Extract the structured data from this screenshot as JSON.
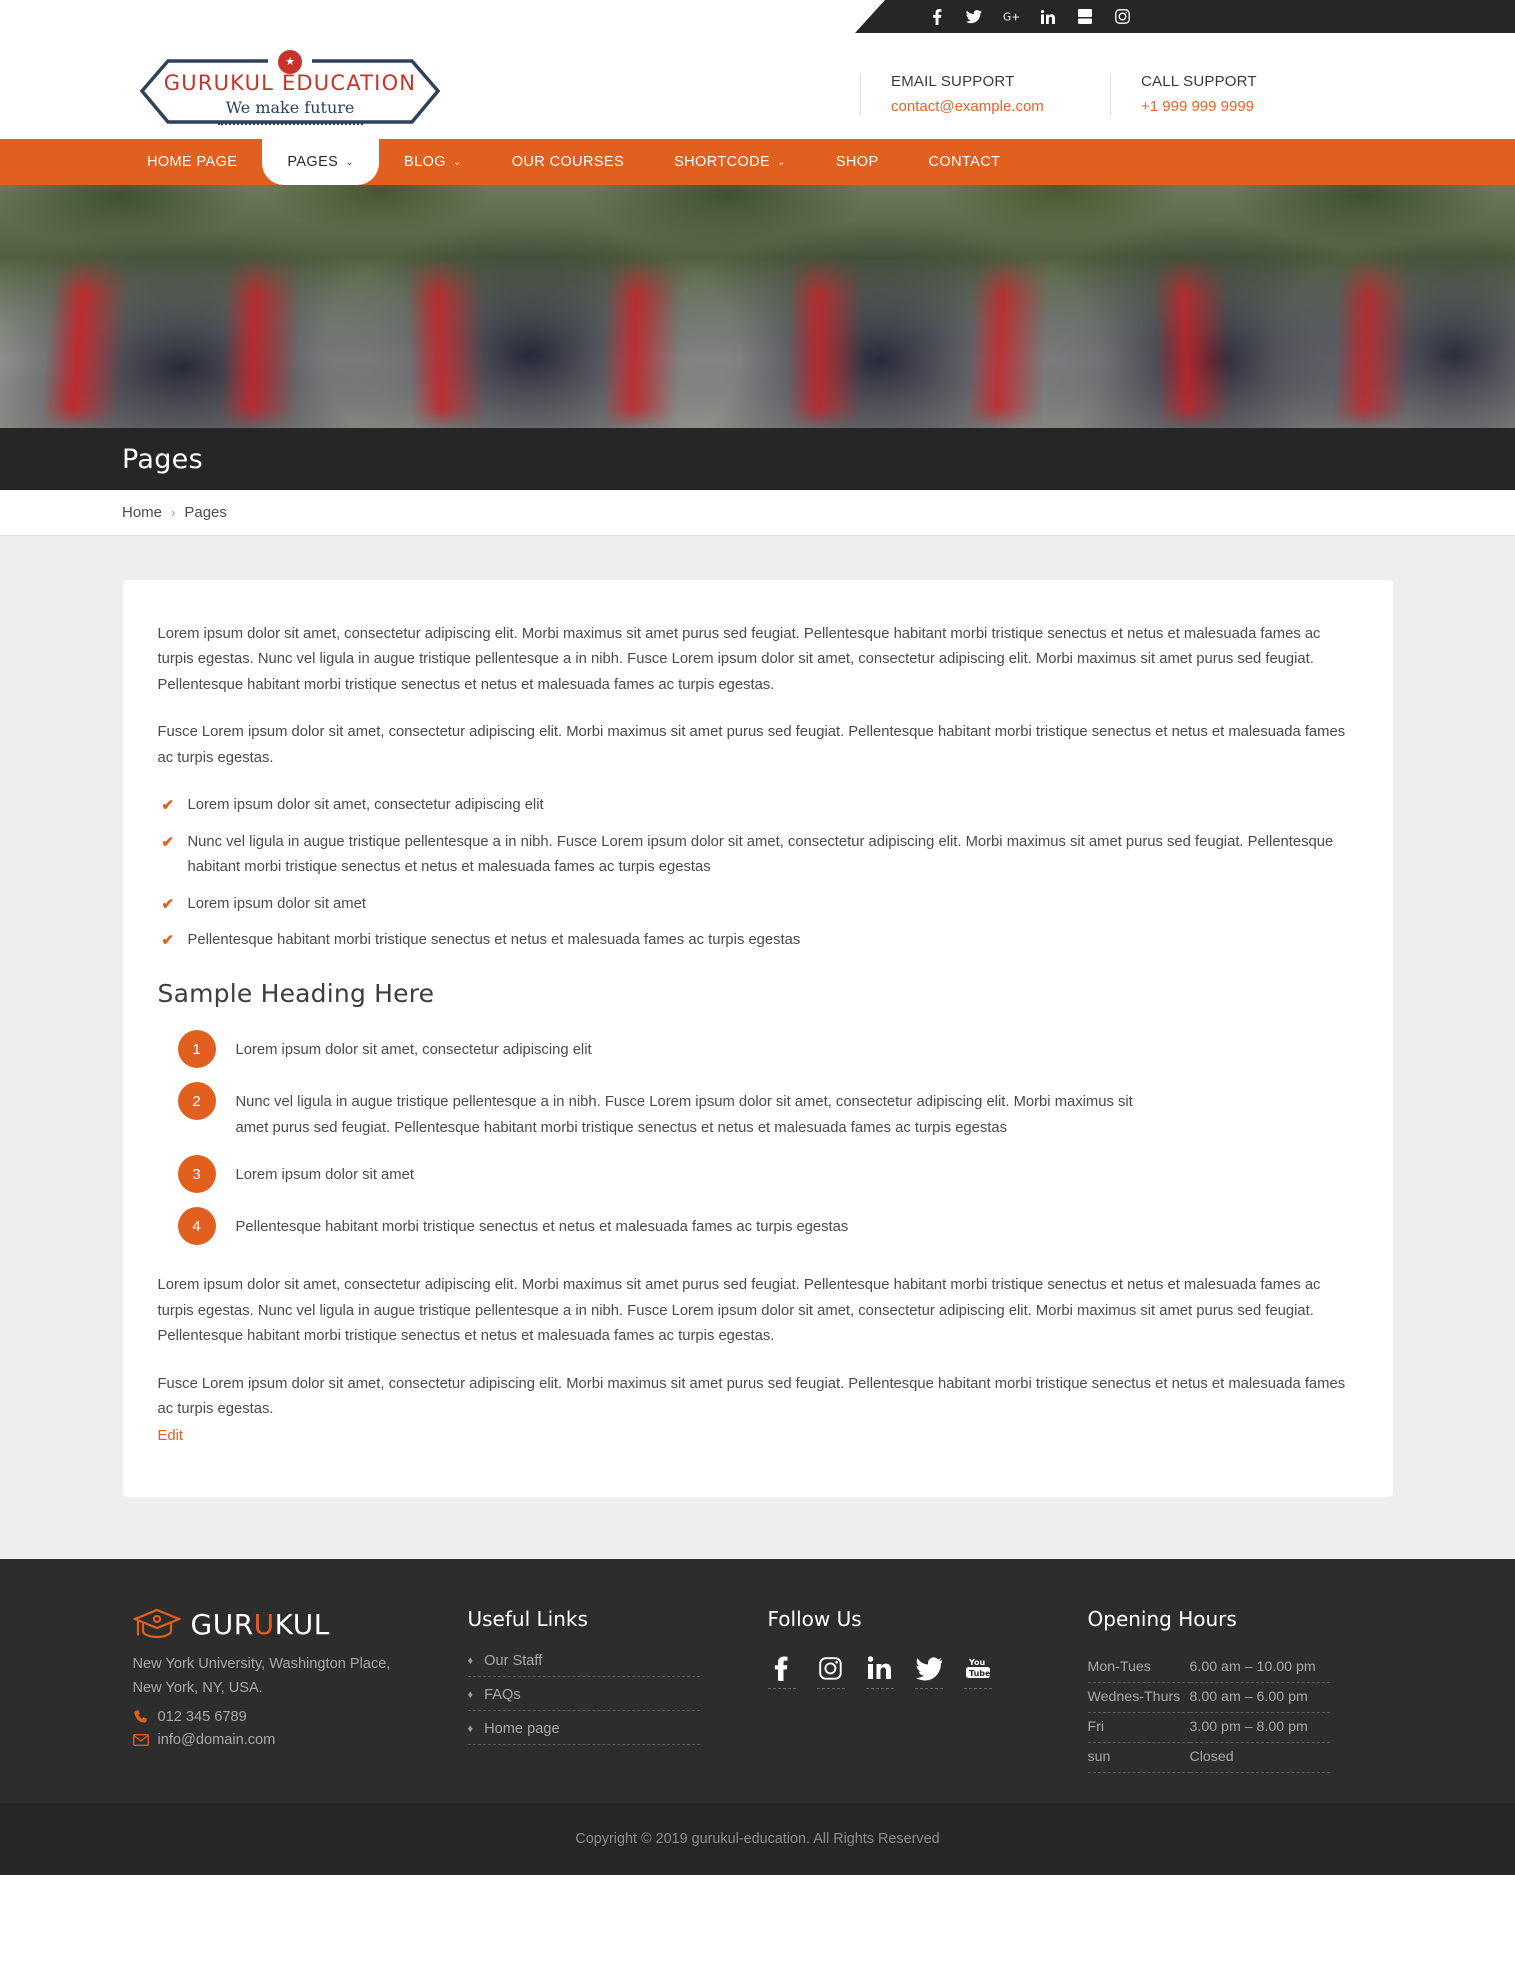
{
  "topbar": {
    "social": [
      {
        "name": "facebook-icon",
        "label": "f"
      },
      {
        "name": "twitter-icon",
        "label": "Twitter"
      },
      {
        "name": "google-plus-icon",
        "label": "G+"
      },
      {
        "name": "linkedin-icon",
        "label": "in"
      },
      {
        "name": "youtube-icon",
        "label": "YouTube"
      },
      {
        "name": "instagram-icon",
        "label": "Instagram"
      }
    ]
  },
  "logo": {
    "title": "Gurukul Education",
    "subtitle": "We make future",
    "badge": "★"
  },
  "support": {
    "email_label": "EMAIL SUPPORT",
    "email_value": "contact@example.com",
    "call_label": "CALL SUPPORT",
    "call_value": "+1 999 999 9999"
  },
  "nav": {
    "items": [
      {
        "label": "HOME PAGE",
        "caret": false,
        "active": false
      },
      {
        "label": "PAGES",
        "caret": true,
        "active": true
      },
      {
        "label": "BLOG",
        "caret": true,
        "active": false
      },
      {
        "label": "OUR COURSES",
        "caret": false,
        "active": false
      },
      {
        "label": "SHORTCODE",
        "caret": true,
        "active": false
      },
      {
        "label": "SHOP",
        "caret": false,
        "active": false
      },
      {
        "label": "CONTACT",
        "caret": false,
        "active": false
      }
    ],
    "caret_glyph": "⌄"
  },
  "page": {
    "title": "Pages",
    "breadcrumb_home": "Home",
    "breadcrumb_sep": "›",
    "breadcrumb_current": "Pages"
  },
  "content": {
    "para1": "Lorem ipsum dolor sit amet, consectetur adipiscing elit. Morbi maximus sit amet purus sed feugiat. Pellentesque habitant morbi tristique senectus et netus et malesuada fames ac turpis egestas. Nunc vel ligula in augue tristique pellentesque a in nibh. Fusce Lorem ipsum dolor sit amet, consectetur adipiscing elit. Morbi maximus sit amet purus sed feugiat. Pellentesque habitant morbi tristique senectus et netus et malesuada fames ac turpis egestas.",
    "para2": "Fusce Lorem ipsum dolor sit amet, consectetur adipiscing elit. Morbi maximus sit amet purus sed feugiat. Pellentesque habitant morbi tristique senectus et netus et malesuada fames ac turpis egestas.",
    "check_icon": "✔",
    "checks": [
      "Lorem ipsum dolor sit amet, consectetur adipiscing elit",
      "Nunc vel ligula in augue tristique pellentesque a in nibh. Fusce Lorem ipsum dolor sit amet, consectetur adipiscing elit. Morbi maximus sit amet purus sed feugiat. Pellentesque habitant morbi tristique senectus et netus et malesuada fames ac turpis egestas",
      "Lorem ipsum dolor sit amet",
      "Pellentesque habitant morbi tristique senectus et netus et malesuada fames ac turpis egestas"
    ],
    "heading": "Sample Heading Here",
    "numbered": [
      {
        "num": "1",
        "text": "Lorem ipsum dolor sit amet, consectetur adipiscing elit"
      },
      {
        "num": "2",
        "text": "Nunc vel ligula in augue tristique pellentesque a in nibh. Fusce Lorem ipsum dolor sit amet, consectetur adipiscing elit. Morbi maximus sit amet purus sed feugiat. Pellentesque habitant morbi tristique senectus et netus et malesuada fames ac turpis egestas"
      },
      {
        "num": "3",
        "text": "Lorem ipsum dolor sit amet"
      },
      {
        "num": "4",
        "text": "Pellentesque habitant morbi tristique senectus et netus et malesuada fames ac turpis egestas"
      }
    ],
    "para3": "Lorem ipsum dolor sit amet, consectetur adipiscing elit. Morbi maximus sit amet purus sed feugiat. Pellentesque habitant morbi tristique senectus et netus et malesuada fames ac turpis egestas. Nunc vel ligula in augue tristique pellentesque a in nibh. Fusce Lorem ipsum dolor sit amet, consectetur adipiscing elit. Morbi maximus sit amet purus sed feugiat. Pellentesque habitant morbi tristique senectus et netus et malesuada fames ac turpis egestas.",
    "para4": "Fusce Lorem ipsum dolor sit amet, consectetur adipiscing elit. Morbi maximus sit amet purus sed feugiat. Pellentesque habitant morbi tristique senectus et netus et malesuada fames ac turpis egestas.",
    "edit_label": "Edit"
  },
  "footer": {
    "brand_part1": "GUR",
    "brand_accent": "U",
    "brand_part2": "KUL",
    "address": "New York University, Washington Place, New York, NY, USA.",
    "phone": "012 345 6789",
    "email": "info@domain.com",
    "links_head": "Useful Links",
    "links": [
      {
        "label": "Our Staff"
      },
      {
        "label": "FAQs"
      },
      {
        "label": "Home page"
      }
    ],
    "bullet": "♦",
    "follow_head": "Follow Us",
    "follow": [
      {
        "name": "facebook-icon"
      },
      {
        "name": "instagram-icon"
      },
      {
        "name": "linkedin-icon"
      },
      {
        "name": "twitter-icon"
      },
      {
        "name": "youtube-icon"
      }
    ],
    "hours_head": "Opening Hours",
    "hours": [
      {
        "day": "Mon-Tues",
        "time": "6.00 am – 10.00 pm"
      },
      {
        "day": "Wednes-Thurs",
        "time": "8.00 am – 6.00 pm"
      },
      {
        "day": "Fri",
        "time": "3.00 pm – 8.00 pm"
      },
      {
        "day": "sun",
        "time": "Closed"
      }
    ],
    "copyright": "Copyright © 2019 gurukul-education. All Rights Reserved"
  },
  "colors": {
    "accent": "#e2601f",
    "dark": "#262626",
    "logo_red": "#c8332b",
    "logo_navy": "#2f4259"
  }
}
